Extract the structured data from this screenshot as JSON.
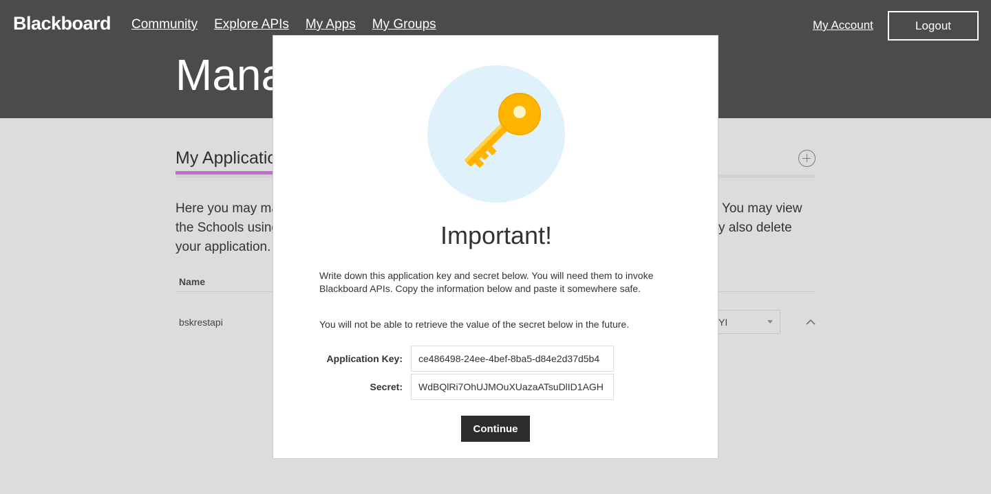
{
  "header": {
    "brand": "Blackboard",
    "nav": [
      "Community",
      "Explore APIs",
      "My Apps",
      "My Groups"
    ],
    "account_link": "My Account",
    "logout_label": "Logout",
    "page_title": "Mana"
  },
  "page": {
    "section_title": "My Applicatio",
    "description_left": [
      "Here you may ma",
      "the Schools using",
      "your application."
    ],
    "description_right": [
      " You may view",
      "y also delete",
      ""
    ],
    "table": {
      "column_name": "Name",
      "rows": [
        {
          "name": "bskrestapi",
          "select_value": "YI"
        }
      ]
    }
  },
  "modal": {
    "title": "Important!",
    "paragraph1": "Write down this application key and secret below. You will need them to invoke Blackboard APIs. Copy the information below and paste it somewhere safe.",
    "paragraph2": "You will not be able to retrieve the value of the secret below in the future.",
    "application_key_label": "Application Key:",
    "application_key_value": "ce486498-24ee-4bef-8ba5-d84e2d37d5b4",
    "secret_label": "Secret:",
    "secret_value": "WdBQlRi7OhUJMOuXUazaATsuDlID1AGH",
    "continue_label": "Continue",
    "icon": "key-icon"
  },
  "colors": {
    "header_bg": "#4b4b4b",
    "accent_underline": "#c16ad0",
    "key_circle_bg": "#dff1fa",
    "key_gold": "#ffb400",
    "continue_bg": "#2c2c2c"
  }
}
